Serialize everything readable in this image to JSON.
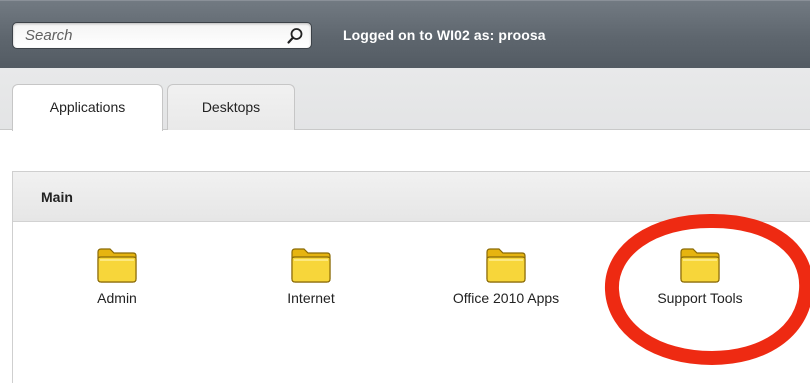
{
  "header": {
    "search_placeholder": "Search",
    "logon_text": "Logged on to WI02 as: proosa"
  },
  "tabs": [
    {
      "label": "Applications",
      "active": true
    },
    {
      "label": "Desktops",
      "active": false
    }
  ],
  "section": {
    "title": "Main",
    "items": [
      {
        "label": "Admin",
        "icon": "folder-icon"
      },
      {
        "label": "Internet",
        "icon": "folder-icon"
      },
      {
        "label": "Office 2010 Apps",
        "icon": "folder-icon"
      },
      {
        "label": "Support Tools",
        "icon": "folder-icon",
        "highlighted": true
      }
    ]
  },
  "colors": {
    "topbar": "#5e666e",
    "folder": "#f4cd2a",
    "highlight_circle": "#ee2a12"
  }
}
